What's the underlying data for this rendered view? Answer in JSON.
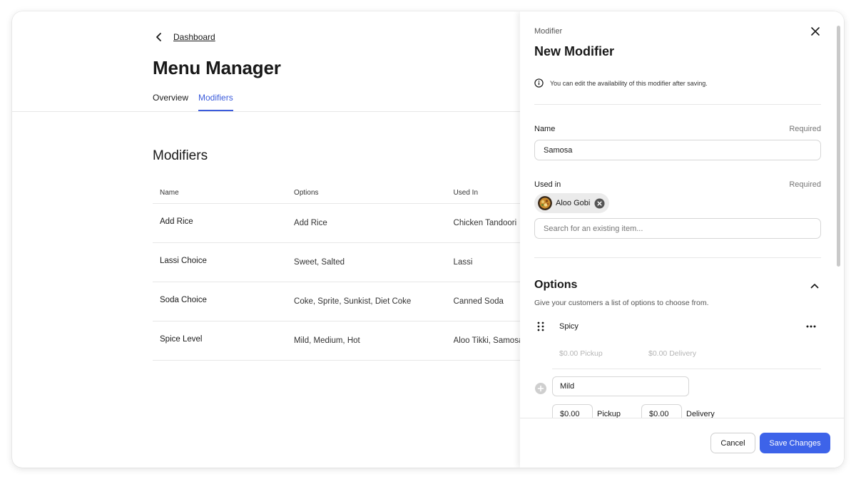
{
  "header": {
    "back_label": "Dashboard",
    "title": "Menu Manager",
    "tabs": [
      {
        "label": "Overview",
        "active": false
      },
      {
        "label": "Modifiers",
        "active": true
      }
    ]
  },
  "modifiers_table": {
    "section_title": "Modifiers",
    "columns": [
      "Name",
      "Options",
      "Used In"
    ],
    "rows": [
      {
        "name": "Add Rice",
        "options": "Add Rice",
        "used_in": "Chicken Tandoori"
      },
      {
        "name": "Lassi Choice",
        "options": "Sweet, Salted",
        "used_in": "Lassi"
      },
      {
        "name": "Soda Choice",
        "options": "Coke, Sprite, Sunkist, Diet Coke",
        "used_in": "Canned Soda"
      },
      {
        "name": "Spice Level",
        "options": "Mild, Medium, Hot",
        "used_in": "Aloo Tikki, Samosa"
      }
    ]
  },
  "panel": {
    "eyebrow": "Modifier",
    "title": "New Modifier",
    "info_text": "You can edit the availability of this modifier after saving.",
    "name_field": {
      "label": "Name",
      "required": "Required",
      "value": "Samosa"
    },
    "used_in_field": {
      "label": "Used in",
      "required": "Required",
      "chip_label": "Aloo Gobi",
      "search_placeholder": "Search for an existing item..."
    },
    "options": {
      "title": "Options",
      "description": "Give your customers a list of options to choose from.",
      "existing": {
        "name": "Spicy",
        "pickup_price": "$0.00 Pickup",
        "delivery_price": "$0.00 Delivery"
      },
      "new_option": {
        "name_value": "Mild",
        "pickup_value": "$0.00",
        "pickup_label": "Pickup",
        "delivery_value": "$0.00",
        "delivery_label": "Delivery"
      }
    },
    "footer": {
      "cancel_label": "Cancel",
      "save_label": "Save Changes"
    }
  },
  "colors": {
    "accent": "#3d63e9",
    "tab_active": "#3b5bdb"
  }
}
